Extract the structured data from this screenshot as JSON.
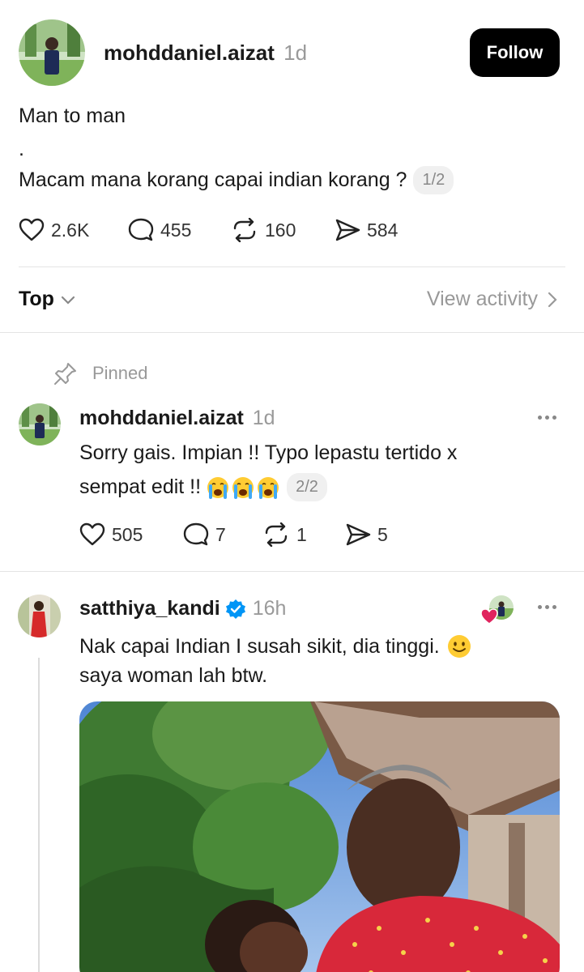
{
  "post": {
    "username": "mohddaniel.aizat",
    "time": "1d",
    "follow_label": "Follow",
    "line1": "Man to man",
    "line2": ".",
    "line3": "Macam mana korang capai indian korang ?",
    "pager": "1/2",
    "likes": "2.6K",
    "comments": "455",
    "reposts": "160",
    "shares": "584"
  },
  "sort": {
    "label": "Top",
    "view_activity": "View activity"
  },
  "pinned_reply": {
    "pinned_label": "Pinned",
    "username": "mohddaniel.aizat",
    "time": "1d",
    "text1": "Sorry gais. Impian !! Typo lepastu tertido x",
    "text2": "sempat edit !!",
    "pager": "2/2",
    "likes": "505",
    "comments": "7",
    "reposts": "1",
    "shares": "5"
  },
  "reply": {
    "username": "satthiya_kandi",
    "time": "16h",
    "text1": "Nak capai Indian I susah sikit, dia tinggi.",
    "text2": "saya woman lah btw."
  },
  "colors": {
    "verified": "#0095f6",
    "heart_badge": "#e0245e",
    "follow_bg": "#000000"
  }
}
